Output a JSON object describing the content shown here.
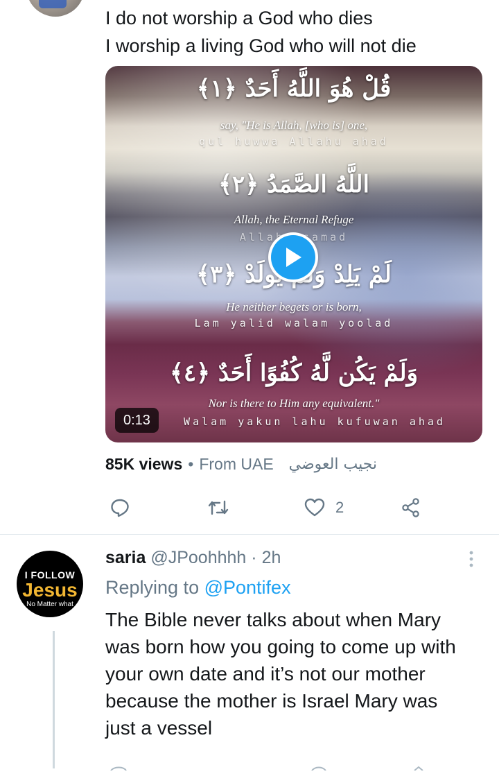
{
  "tweet1": {
    "lines": [
      "I do not worship a God who dies",
      "I worship a living God who will not die"
    ],
    "video": {
      "verses": [
        {
          "arabic": "قُلْ هُوَ اللَّهُ أَحَدٌ ﴿١﴾",
          "english": "say, \"He is Allah, [who is] one,",
          "translit": "qul huwwa Allahu ahad"
        },
        {
          "arabic": "اللَّهُ الصَّمَدُ ﴿٢﴾",
          "english": "Allah, the Eternal Refuge",
          "translit": "Allahu samad"
        },
        {
          "arabic": "لَمْ يَلِدْ وَلَمْ يُولَدْ ﴿٣﴾",
          "english": "He neither begets or is born,",
          "translit": "Lam yalid walam yoolad"
        },
        {
          "arabic": "وَلَمْ يَكُن لَّهُ كُفُوًا أَحَدٌ ﴿٤﴾",
          "english": "Nor is there to Him any equivalent.\"",
          "translit": "Walam yakun lahu kufuwan ahad"
        }
      ],
      "duration": "0:13"
    },
    "meta": {
      "views": "85K views",
      "separator": "•",
      "from": "From UAE",
      "user_arabic": "نجيب العوضي"
    },
    "actions": {
      "like_count": "2"
    }
  },
  "tweet2": {
    "avatar": {
      "line1": "I FOLLOW",
      "line2": "Jesus",
      "line3": "No Matter what"
    },
    "name": "saria",
    "handle": "@JPoohhhh",
    "separator": "·",
    "time": "2h",
    "reply_prefix": "Replying to",
    "reply_mention": "@Pontifex",
    "lines": [
      "The Bible never talks about when Mary",
      "was born how you going to come up with",
      "your own date and it’s not our mother",
      "because the mother is Israel Mary was",
      "just a vessel"
    ]
  },
  "colors": {
    "accent": "#1da1f2",
    "muted": "#657786",
    "text": "#14171a"
  }
}
